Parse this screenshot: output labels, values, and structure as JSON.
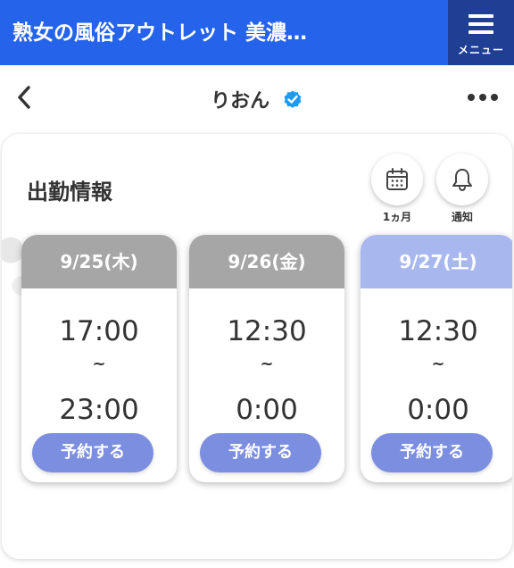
{
  "topbar": {
    "site_title": "熟女の風俗アウトレット 美濃…",
    "menu_label": "メニュー"
  },
  "header": {
    "profile_name": "りおん"
  },
  "schedule": {
    "title": "出勤情報",
    "month_label": "1ヵ月",
    "notify_label": "通知",
    "cards": [
      {
        "date": "9/25(木)",
        "start": "17:00",
        "sep": "~",
        "end": "23:00",
        "reserve_label": "予約する",
        "header_color": "#a6a6a6"
      },
      {
        "date": "9/26(金)",
        "start": "12:30",
        "sep": "~",
        "end": "0:00",
        "reserve_label": "予約する",
        "header_color": "#a6a6a6"
      },
      {
        "date": "9/27(土)",
        "start": "12:30",
        "sep": "~",
        "end": "0:00",
        "reserve_label": "予約する",
        "header_color": "#a8b8ef"
      }
    ]
  },
  "colors": {
    "topbar": "#2563eb",
    "menu_button": "#1f3f95",
    "reserve_button": "#7b8ee0",
    "verified_badge": "#1d9bf0"
  }
}
